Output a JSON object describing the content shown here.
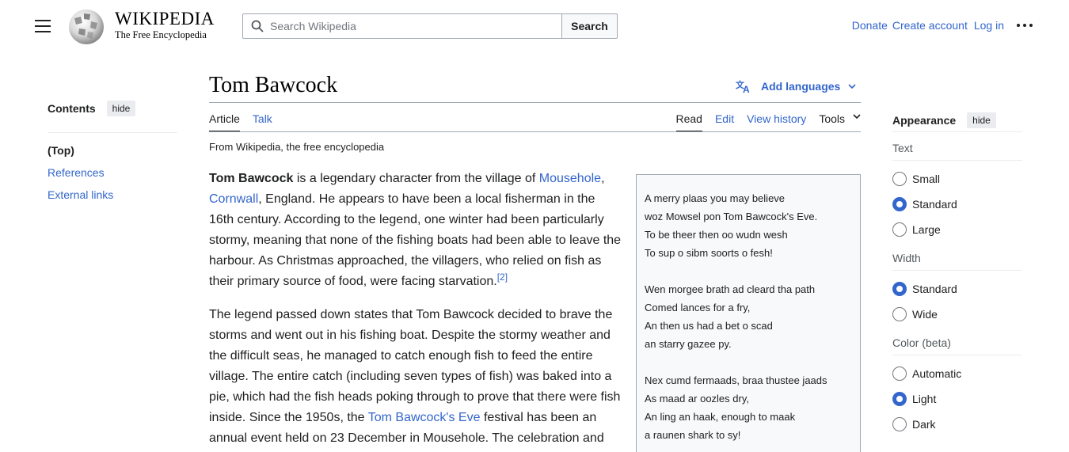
{
  "header": {
    "wordmark_title": "WIKIPEDIA",
    "wordmark_subtitle": "The Free Encyclopedia",
    "search_placeholder": "Search Wikipedia",
    "search_button": "Search",
    "donate": "Donate",
    "create_account": "Create account",
    "log_in": "Log in"
  },
  "toc": {
    "title": "Contents",
    "hide": "hide",
    "items": [
      "(Top)",
      "References",
      "External links"
    ]
  },
  "article": {
    "title": "Tom Bawcock",
    "add_languages": "Add languages",
    "tab_article": "Article",
    "tab_talk": "Talk",
    "tab_read": "Read",
    "tab_edit": "Edit",
    "tab_history": "View history",
    "tab_tools": "Tools",
    "tagline": "From Wikipedia, the free encyclopedia",
    "p1": {
      "bold": "Tom Bawcock",
      "t1": " is a legendary character from the village of ",
      "link1": "Mousehole",
      "t2": ", ",
      "link2": "Cornwall",
      "t3": ", England. He appears to have been a local fisherman in the 16th century. According to the legend, one winter had been particularly stormy, meaning that none of the fishing boats had been able to leave the harbour. As Christmas approached, the villagers, who relied on fish as their primary source of food, were facing starvation.",
      "ref": "[2]"
    },
    "p2": {
      "t1": "The legend passed down states that Tom Bawcock decided to brave the storms and went out in his fishing boat. Despite the stormy weather and the difficult seas, he managed to catch enough fish to feed the entire village. The entire catch (including seven types of fish) was baked into a pie, which had the fish heads poking through to prove that there were fish inside. Since the 1950s, the ",
      "link1": "Tom Bawcock's Eve",
      "t2": " festival has been an annual event held on 23 December in Mousehole. The celebration and"
    }
  },
  "poem": {
    "stanzas": [
      [
        "A merry plaas you may believe",
        "woz Mowsel pon Tom Bawcock's Eve.",
        "To be theer then oo wudn wesh",
        "To sup o sibm soorts o fesh!"
      ],
      [
        "Wen morgee brath ad cleard tha path",
        "Comed lances for a fry,",
        "An then us had a bet o scad",
        "an starry gazee py."
      ],
      [
        "Nex cumd fermaads, braa thustee jaads",
        "As maad ar oozles dry,",
        "An ling an haak, enough to maak",
        "a raunen shark to sy!"
      ]
    ]
  },
  "appearance": {
    "title": "Appearance",
    "hide": "hide",
    "text_label": "Text",
    "text_options": [
      "Small",
      "Standard",
      "Large"
    ],
    "text_selected": "Standard",
    "width_label": "Width",
    "width_options": [
      "Standard",
      "Wide"
    ],
    "width_selected": "Standard",
    "color_label": "Color (beta)",
    "color_options": [
      "Automatic",
      "Light",
      "Dark"
    ],
    "color_selected": "Light"
  },
  "colors": {
    "link": "#3366cc",
    "text": "#202122",
    "border": "#a2a9b1",
    "panel_bg": "#f8f9fa"
  }
}
